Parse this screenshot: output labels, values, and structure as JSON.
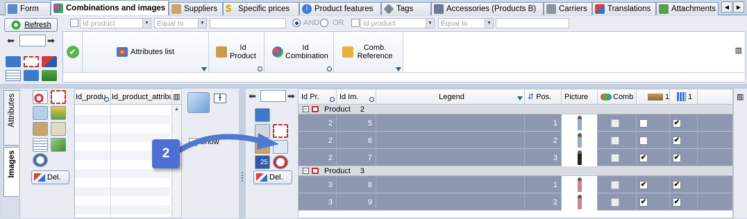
{
  "tabs": [
    {
      "label": "Form",
      "icon": "form-icon"
    },
    {
      "label": "Combinations and images",
      "icon": "combinations-icon",
      "active": true
    },
    {
      "label": "Suppliers",
      "icon": "suppliers-icon"
    },
    {
      "label": "Specific prices",
      "icon": "dollar-icon"
    },
    {
      "label": "Product features",
      "icon": "info-icon"
    },
    {
      "label": "Tags",
      "icon": "tag-icon"
    },
    {
      "label": "Accessories (Products B)",
      "icon": "accessories-icon"
    },
    {
      "label": "Carriers",
      "icon": "carrier-icon"
    },
    {
      "label": "Translations",
      "icon": "translations-icon"
    },
    {
      "label": "Attachments",
      "icon": "attachments-icon"
    }
  ],
  "toolbar": {
    "refresh_label": "Refresh",
    "page_value": ""
  },
  "filter": {
    "field1": "Id product",
    "op1": "Equal to",
    "value1": "",
    "and_label": "AND",
    "or_label": "OR",
    "field2": "Id product",
    "op2": "Equal to",
    "value2": "",
    "selected_logic": "AND"
  },
  "combination_columns": [
    {
      "label": "Attributes list"
    },
    {
      "label": "Id Product"
    },
    {
      "label": "Id Combination"
    },
    {
      "label": "Comb. Reference"
    }
  ],
  "side_tabs": {
    "attributes": "Attributes",
    "images": "Images"
  },
  "attributes_panel": {
    "col1": "Id_produ",
    "col2": "Id_product_attribut",
    "del_label": "Del."
  },
  "middle": {
    "show_label": "Show"
  },
  "images_panel": {
    "page_value": "",
    "size_value": "25",
    "del_label": "Del."
  },
  "image_grid": {
    "headers": [
      "Id Pr.",
      "Id Im.",
      "Legend",
      "Pos.",
      "Picture",
      "Comb",
      "1",
      "1"
    ],
    "groups": [
      {
        "label": "Product",
        "id": "2",
        "rows": [
          {
            "id_product": "2",
            "id_image": "5",
            "legend": "",
            "position": "1",
            "comb": false,
            "a": false,
            "b": true
          },
          {
            "id_product": "2",
            "id_image": "6",
            "legend": "",
            "position": "2",
            "comb": false,
            "a": false,
            "b": true
          },
          {
            "id_product": "2",
            "id_image": "7",
            "legend": "",
            "position": "3",
            "comb": false,
            "a": true,
            "b": true
          }
        ]
      },
      {
        "label": "Product",
        "id": "3",
        "rows": [
          {
            "id_product": "3",
            "id_image": "8",
            "legend": "",
            "position": "1",
            "comb": false,
            "a": true,
            "b": true
          },
          {
            "id_product": "3",
            "id_image": "9",
            "legend": "",
            "position": "2",
            "comb": false,
            "a": true,
            "b": true
          }
        ]
      }
    ]
  },
  "callout": {
    "number": "2"
  },
  "colors": {
    "accent": "#4f6ed3",
    "row_selected": "#8d97b0",
    "group_row": "#d9dde3"
  }
}
